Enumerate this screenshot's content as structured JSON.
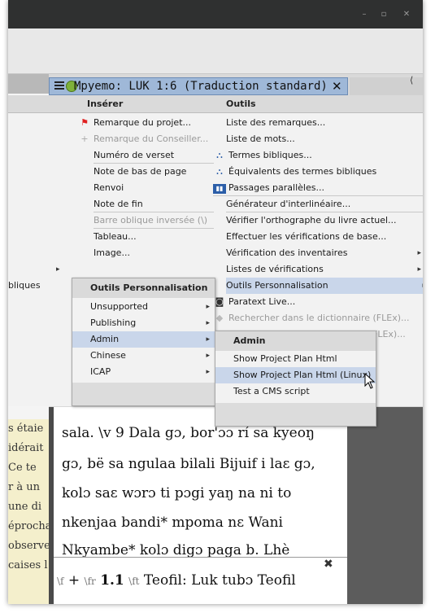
{
  "window": {
    "controls": [
      "–",
      "▫",
      "✕"
    ]
  },
  "tab": {
    "title": "Mpyemo: LUK 1:6 (Traduction standard)",
    "close": "✕",
    "right_arrow": "⟨"
  },
  "menubar": {
    "insert": "Insérer",
    "tools": "Outils"
  },
  "insert_menu": {
    "items": [
      {
        "label": "Remarque du projet...",
        "icon": "red-flag-icon",
        "disabled": false
      },
      {
        "label": "Remarque du Conseiller...",
        "icon": "plus-icon",
        "disabled": true
      },
      {
        "label": "Numéro de verset",
        "disabled": false
      },
      {
        "label": "Note de bas de page",
        "disabled": false
      },
      {
        "label": "Renvoi",
        "disabled": false
      },
      {
        "label": "Note de fin",
        "disabled": false
      },
      {
        "label": "Barre oblique inversée (\\)",
        "disabled": true
      },
      {
        "label": "Tableau...",
        "disabled": false
      },
      {
        "label": "Image...",
        "disabled": false
      }
    ]
  },
  "tools_menu": {
    "items": [
      {
        "label": "Liste des remarques...",
        "icon": ""
      },
      {
        "label": "Liste de mots...",
        "icon": ""
      },
      {
        "label": "Termes bibliques...",
        "icon": "biblical-terms-icon"
      },
      {
        "label": "Équivalents des termes bibliques",
        "icon": "biblical-terms-icon"
      },
      {
        "label": "Passages parallèles...",
        "icon": "parallel-passages-icon"
      },
      {
        "label": "Générateur d'interlinéaire...",
        "icon": ""
      },
      {
        "label": "Vérifier l'orthographe du livre actuel...",
        "icon": ""
      },
      {
        "label": "Effectuer les vérifications de base...",
        "icon": ""
      },
      {
        "label": "Vérification des inventaires",
        "icon": "",
        "submenu": true
      },
      {
        "label": "Listes de vérifications",
        "icon": "",
        "submenu": true
      },
      {
        "label": "Outils Personnalisation",
        "icon": "",
        "submenu": true,
        "highlighted": true
      },
      {
        "label": "Paratext Live...",
        "icon": "paratext-live-icon"
      },
      {
        "label": "Rechercher dans le dictionnaire (FLEx)...",
        "icon": "dictionary-icon",
        "disabled": true
      },
      {
        "label": "FLEx)...",
        "icon": "",
        "disabled": true
      }
    ]
  },
  "left_label": "bliques",
  "custom_menu": {
    "header": "Outils Personnalisation",
    "items": [
      {
        "label": "Unsupported",
        "highlighted": false
      },
      {
        "label": "Publishing",
        "highlighted": false
      },
      {
        "label": "Admin",
        "highlighted": true
      },
      {
        "label": "Chinese",
        "highlighted": false
      },
      {
        "label": "ICAP",
        "highlighted": false
      }
    ]
  },
  "admin_menu": {
    "header": "Admin",
    "items": [
      {
        "label": "Show Project Plan Html",
        "highlighted": false
      },
      {
        "label": "Show Project Plan Html (Linux)",
        "highlighted": true
      },
      {
        "label": "Test a CMS script",
        "highlighted": false
      }
    ]
  },
  "left_scripture": [
    "s étaie",
    "idérait",
    "Ce te",
    "r à un",
    "une di",
    "éprocha",
    "observe",
    "caises l"
  ],
  "editor": {
    "lines": [
      "sala. \\v 9 Dala gɔ, bor'ɔɔ rí sa kyeoŋ",
      "gɔ, bë sa ngulaa bilali Bijuif i laɛ gɔ,",
      "kolɔ saɛ wɔrɔ ti pɔgi yaŋ na ni to",
      "nkenjaa bandi* mpoma nɛ Wani",
      "Nkyambe* kolɔ digɔ paga b. Lhè"
    ]
  },
  "footnote": {
    "close": "✖",
    "tag_f": "\\f",
    "plus": "+",
    "tag_fr": "\\fr",
    "ref": "1.1",
    "tag_ft": "\\ft",
    "text": "Teofil: Luk tubɔ Teofil"
  },
  "colors": {
    "highlight": "#c9d6ea",
    "tab": "#9fb8d8",
    "menu_bg": "#f2f2f2"
  }
}
